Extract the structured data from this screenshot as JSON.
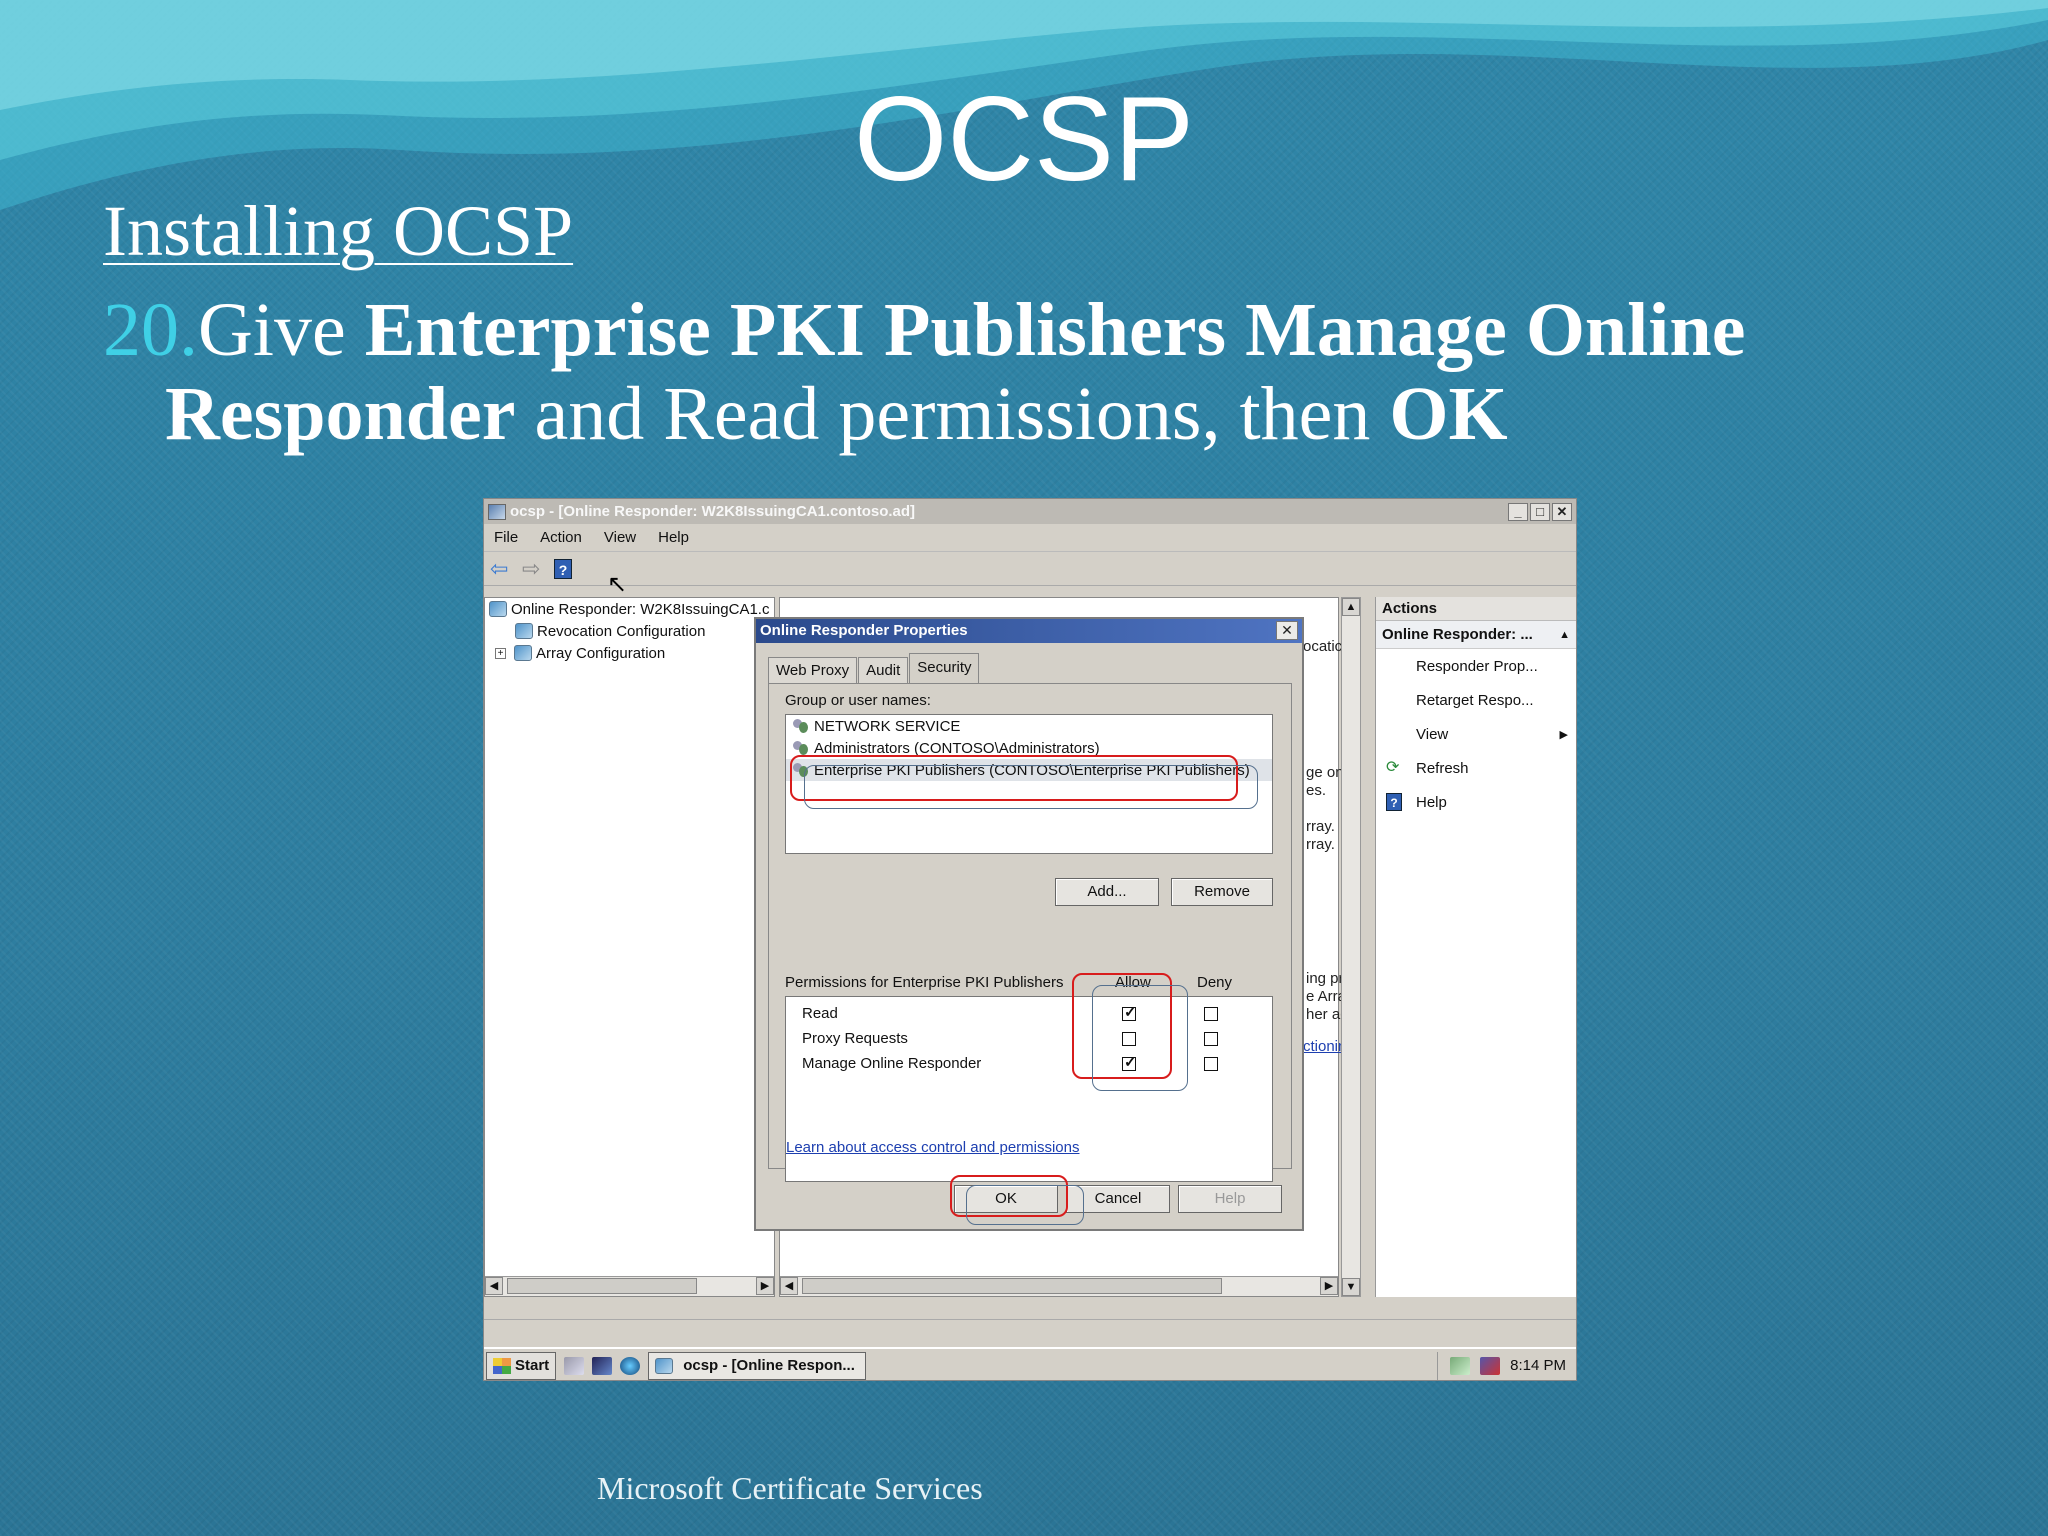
{
  "slide": {
    "title": "OCSP",
    "subtitle": "Installing OCSP",
    "step": {
      "number": "20.",
      "t1": "Give ",
      "b1": "Enterprise PKI Publishers Manage Online",
      "b2": "Responder",
      "t2": " and Read permissions, then ",
      "b3": "OK"
    },
    "footer": "Microsoft Certificate Services"
  },
  "window": {
    "title": "ocsp - [Online Responder: W2K8IssuingCA1.contoso.ad]",
    "controls": [
      "_",
      "□",
      "✕"
    ],
    "menu": [
      "File",
      "Action",
      "View",
      "Help"
    ],
    "toolbar_help": "?"
  },
  "tree": {
    "root": "Online Responder: W2K8IssuingCA1.c",
    "child1": "Revocation Configuration",
    "child2": "Array Configuration",
    "expander": "+"
  },
  "center_fragments": {
    "f1": "ocatic",
    "f2": "ge on",
    "f3": "es.",
    "f4": "rray.",
    "f5": "rray.",
    "f6": "ing pr",
    "f7": "e Arra",
    "f8": "her ac",
    "f9": "ctionin"
  },
  "actions": {
    "header": "Actions",
    "section": "Online Responder: ...",
    "items": [
      {
        "label": "Responder Prop..."
      },
      {
        "label": "Retarget Respo..."
      },
      {
        "label": "View"
      },
      {
        "label": "Refresh"
      },
      {
        "label": "Help"
      }
    ]
  },
  "dialog": {
    "title": "Online Responder Properties",
    "close": "✕",
    "tabs": [
      "Web Proxy",
      "Audit",
      "Security"
    ],
    "active_tab": "Security",
    "group_label": "Group or user names:",
    "users": [
      "NETWORK SERVICE",
      "Administrators (CONTOSO\\Administrators)",
      "Enterprise PKI Publishers (CONTOSO\\Enterprise PKI Publishers)"
    ],
    "add_label": "Add...",
    "remove_label": "Remove",
    "perm_label": "Permissions for Enterprise PKI Publishers",
    "allow_label": "Allow",
    "deny_label": "Deny",
    "permissions": [
      {
        "name": "Read",
        "allow": true,
        "deny": false
      },
      {
        "name": "Proxy Requests",
        "allow": false,
        "deny": false
      },
      {
        "name": "Manage Online Responder",
        "allow": true,
        "deny": false
      }
    ],
    "link": "Learn about access control and permissions",
    "ok_label": "OK",
    "cancel_label": "Cancel",
    "help_label": "Help"
  },
  "taskbar": {
    "start": "Start",
    "task": "ocsp - [Online Respon...",
    "clock": "8:14 PM"
  },
  "colors": {
    "background": "#2f7d9f",
    "accent_number": "#3fd0e6",
    "highlight_red": "#d81c1c",
    "dialog_title": "#2b4a8c"
  }
}
